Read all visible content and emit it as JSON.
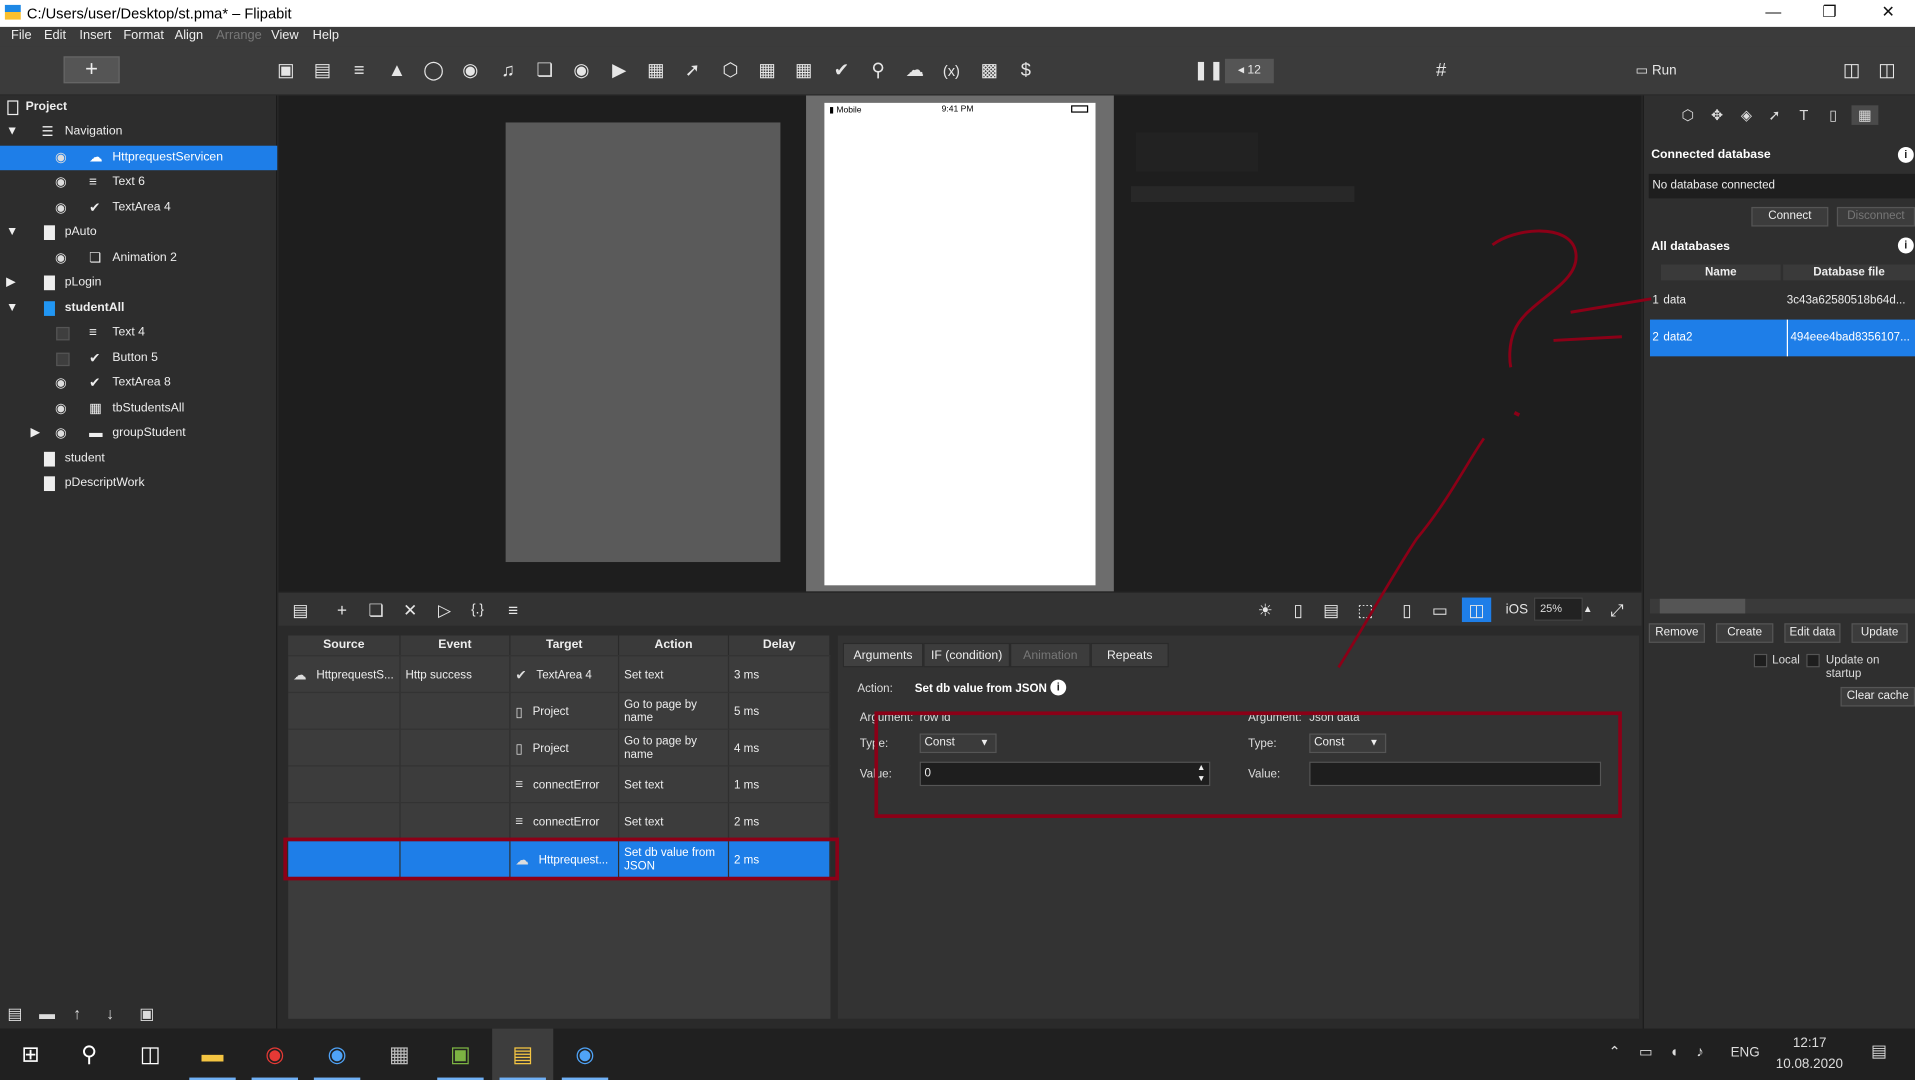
{
  "window": {
    "title": "C:/Users/user/Desktop/st.pma* – Flipabit"
  },
  "menu": [
    "File",
    "Edit",
    "Insert",
    "Format",
    "Align",
    "Arrange",
    "View",
    "Help"
  ],
  "toolbar": {
    "add_label": "+",
    "counter": "12",
    "run_label": "Run"
  },
  "tree": {
    "root": "Project",
    "items": [
      {
        "label": "Navigation"
      },
      {
        "label": "HttprequestServicen"
      },
      {
        "label": "Text 6"
      },
      {
        "label": "TextArea 4"
      },
      {
        "label": "pAuto"
      },
      {
        "label": "Animation 2"
      },
      {
        "label": "pLogin"
      },
      {
        "label": "studentAll"
      },
      {
        "label": "Text 4"
      },
      {
        "label": "Button 5"
      },
      {
        "label": "TextArea 8"
      },
      {
        "label": "tbStudentsAll"
      },
      {
        "label": "groupStudent"
      },
      {
        "label": "student"
      },
      {
        "label": "pDescriptWork"
      }
    ]
  },
  "device": {
    "carrier": "Mobile",
    "time": "9:41 PM"
  },
  "canvas_toolbar": {
    "platform": "iOS",
    "zoom": "25%"
  },
  "events": {
    "headers": [
      "Source",
      "Event",
      "Target",
      "Action",
      "Delay"
    ],
    "rows": [
      {
        "source": "HttprequestS...",
        "event": "Http success",
        "target": "TextArea 4",
        "action": "Set text",
        "delay": "3 ms"
      },
      {
        "source": "",
        "event": "",
        "target": "Project",
        "action": "Go to page by name",
        "delay": "5 ms"
      },
      {
        "source": "",
        "event": "",
        "target": "Project",
        "action": "Go to page by name",
        "delay": "4 ms"
      },
      {
        "source": "",
        "event": "",
        "target": "connectError",
        "action": "Set text",
        "delay": "1 ms"
      },
      {
        "source": "",
        "event": "",
        "target": "connectError",
        "action": "Set text",
        "delay": "2 ms"
      },
      {
        "source": "",
        "event": "",
        "target": "Httprequest...",
        "action": "Set db value from JSON",
        "delay": "2 ms"
      }
    ]
  },
  "args": {
    "tabs": [
      "Arguments",
      "IF (condition)",
      "Animation",
      "Repeats"
    ],
    "action_label": "Action:",
    "action_value": "Set db value from JSON",
    "arg1": {
      "arg_label": "Argument:",
      "arg_value": "row id",
      "type_label": "Type:",
      "type_value": "Const",
      "value_label": "Value:",
      "value": "0"
    },
    "arg2": {
      "arg_label": "Argument:",
      "arg_value": "Json data",
      "type_label": "Type:",
      "type_value": "Const",
      "value_label": "Value:",
      "value": ""
    }
  },
  "database": {
    "connected_title": "Connected database",
    "connected_value": "No database connected",
    "connect": "Connect",
    "disconnect": "Disconnect",
    "all_title": "All databases",
    "headers": [
      "Name",
      "Database file"
    ],
    "rows": [
      {
        "num": "1",
        "name": "data",
        "file": "3c43a62580518b64d..."
      },
      {
        "num": "2",
        "name": "data2",
        "file": "494eee4bad8356107..."
      }
    ],
    "buttons": [
      "Remove",
      "Create",
      "Edit data",
      "Update"
    ],
    "local": "Local",
    "update_on_startup": "Update on startup",
    "clear_cache": "Clear cache"
  },
  "taskbar": {
    "lang": "ENG",
    "time": "12:17",
    "date": "10.08.2020",
    "notif": "1"
  },
  "colors": {
    "accent": "#1e7ee8",
    "annotation": "#8b0017"
  }
}
